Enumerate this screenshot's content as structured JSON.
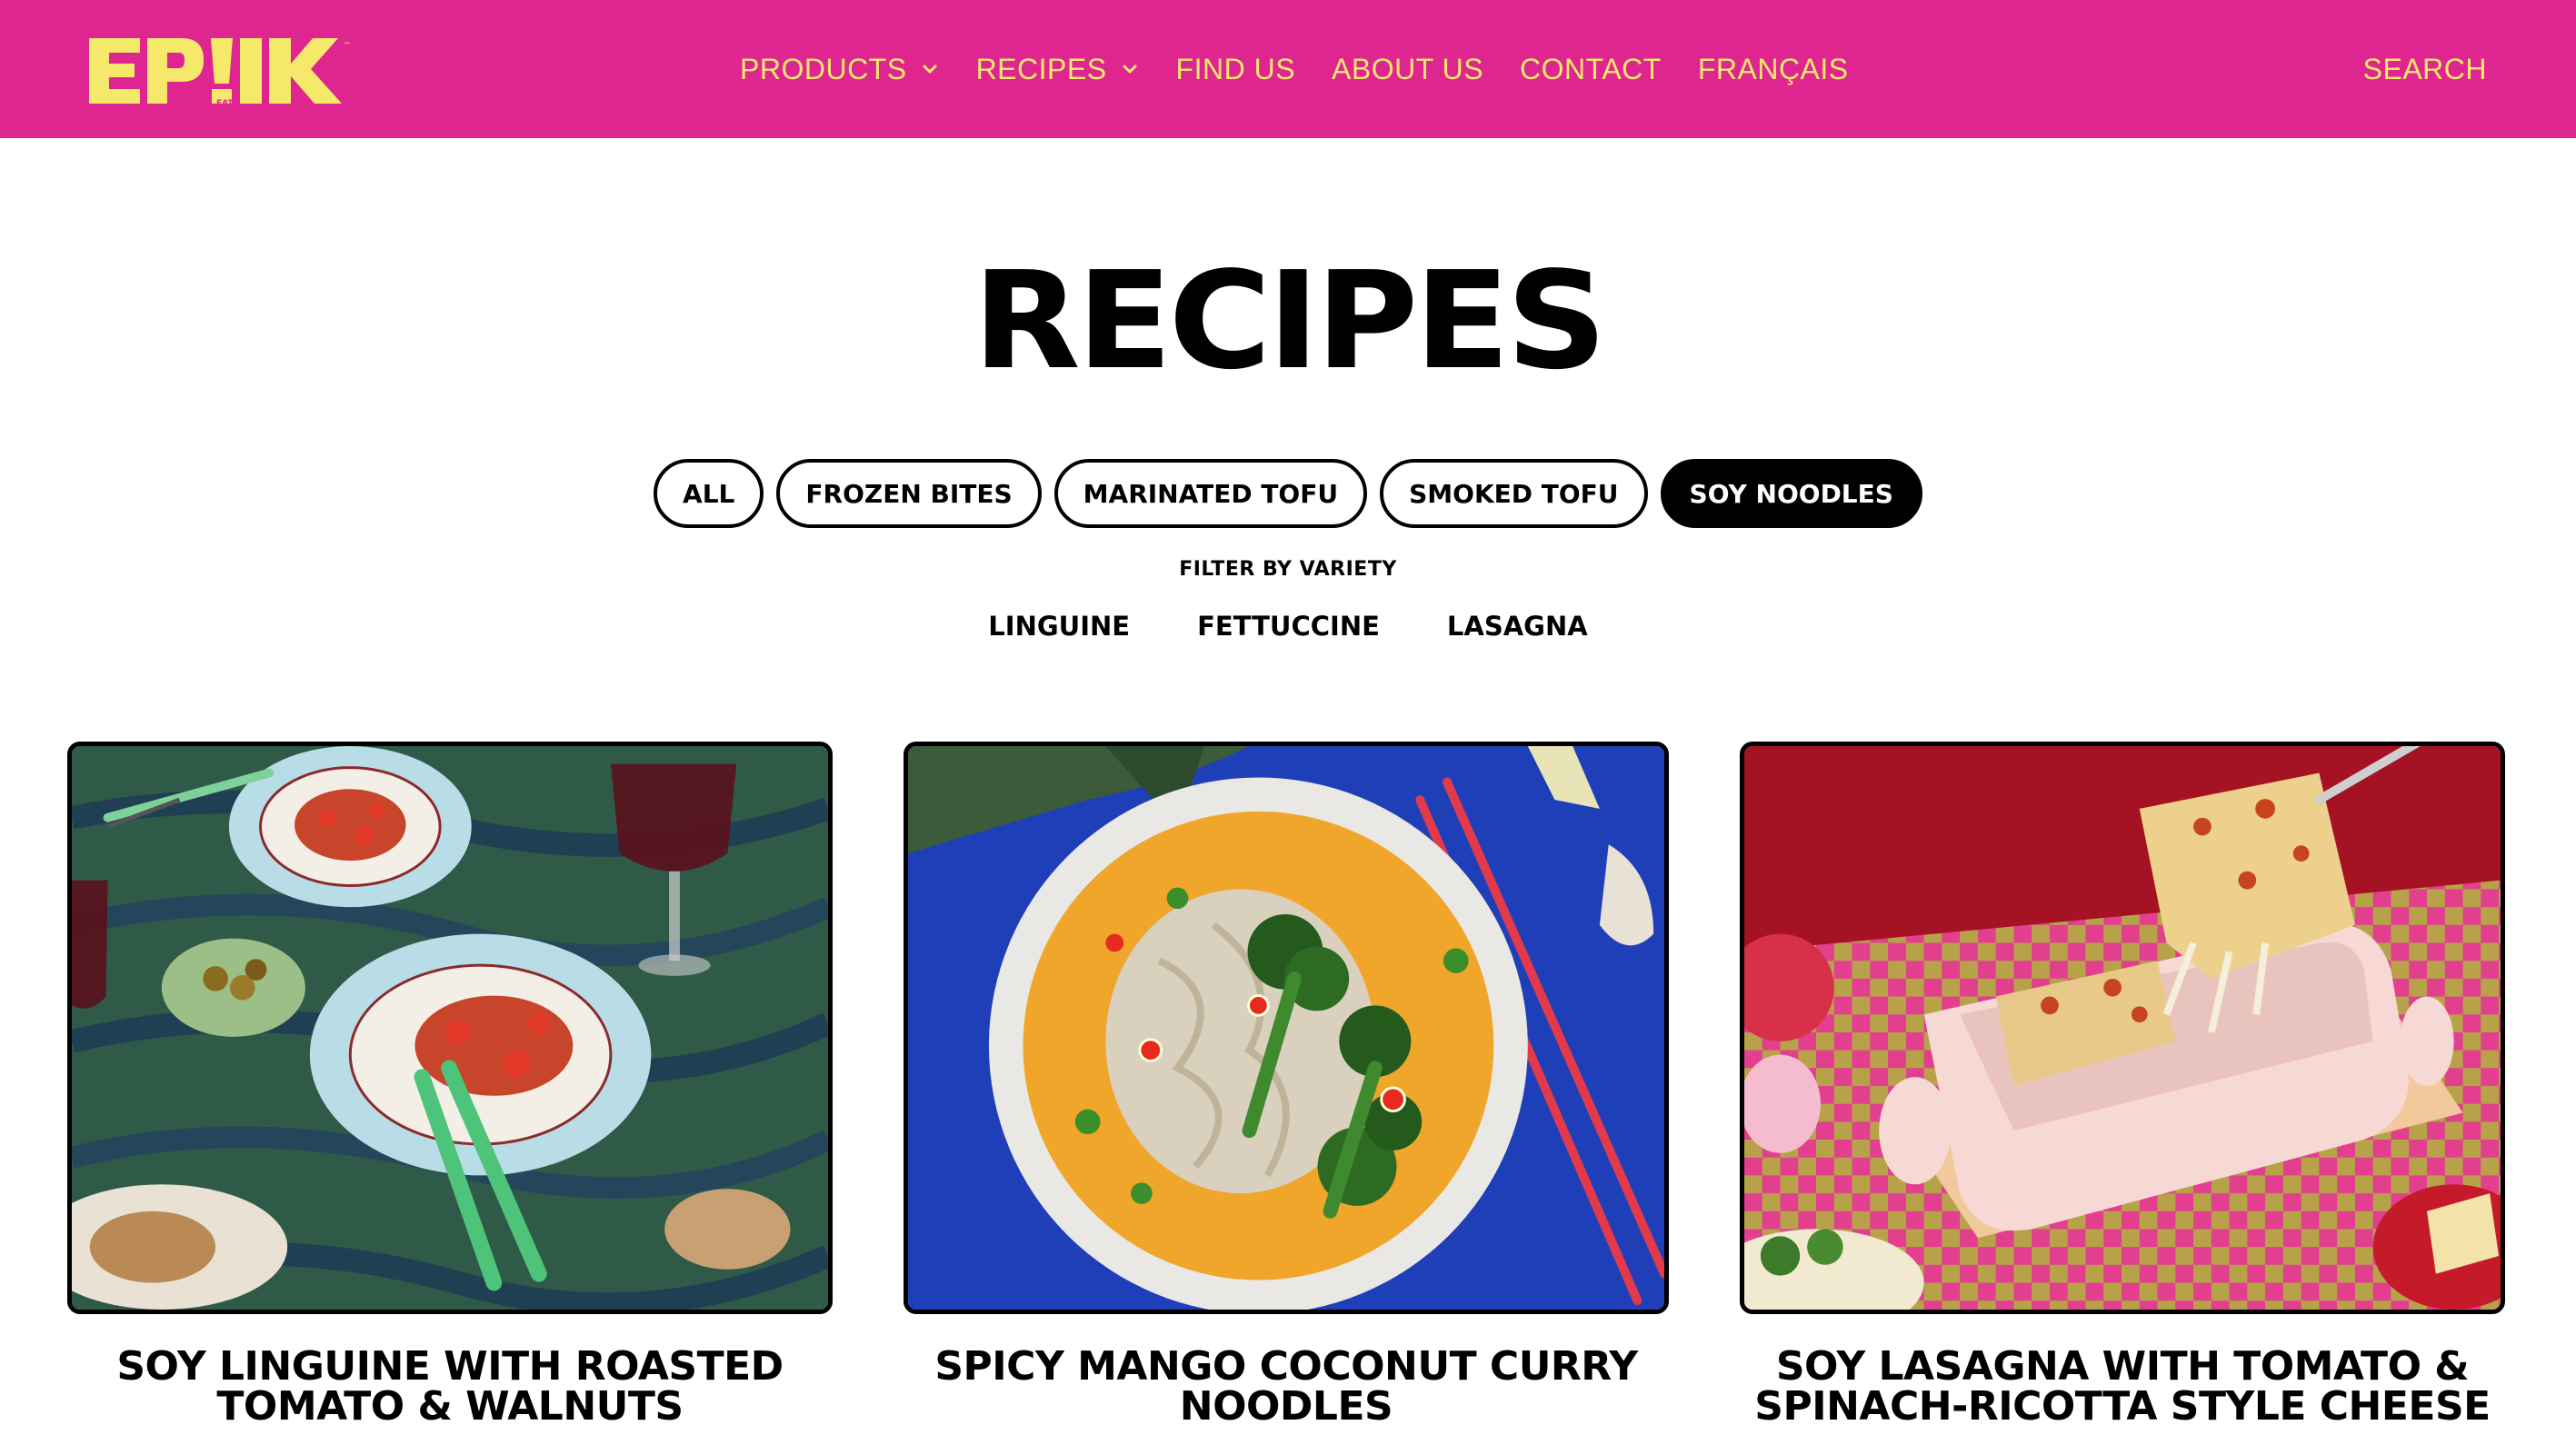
{
  "header": {
    "logo_text": "EP!K",
    "logo_subtext": "EATS",
    "nav": [
      {
        "label": "PRODUCTS",
        "has_dropdown": true
      },
      {
        "label": "RECIPES",
        "has_dropdown": true
      },
      {
        "label": "FIND US",
        "has_dropdown": false
      },
      {
        "label": "ABOUT US",
        "has_dropdown": false
      },
      {
        "label": "CONTACT",
        "has_dropdown": false
      },
      {
        "label": "FRANÇAIS",
        "has_dropdown": false
      }
    ],
    "search_label": "SEARCH"
  },
  "page": {
    "title": "RECIPES"
  },
  "categories": [
    {
      "label": "ALL",
      "active": false
    },
    {
      "label": "FROZEN BITES",
      "active": false
    },
    {
      "label": "MARINATED TOFU",
      "active": false
    },
    {
      "label": "SMOKED TOFU",
      "active": false
    },
    {
      "label": "SOY NOODLES",
      "active": true
    }
  ],
  "filter": {
    "label": "FILTER BY VARIETY",
    "varieties": [
      "LINGUINE",
      "FETTUCCINE",
      "LASAGNA"
    ]
  },
  "recipes": [
    {
      "title": "SOY LINGUINE WITH ROASTED TOMATO & WALNUTS",
      "image": "linguine-plates-photo"
    },
    {
      "title": "SPICY MANGO COCONUT CURRY NOODLES",
      "image": "curry-noodle-bowl-photo"
    },
    {
      "title": "SOY LASAGNA WITH TOMATO & SPINACH-RICOTTA STYLE CHEESE",
      "image": "lasagna-dish-photo"
    }
  ],
  "colors": {
    "header_bg": "#df2590",
    "nav_text": "#f5e86b",
    "logo": "#f5e86b",
    "active_pill_bg": "#000000",
    "text": "#000000"
  },
  "icons": {
    "dropdown": "chevron-down-icon"
  }
}
